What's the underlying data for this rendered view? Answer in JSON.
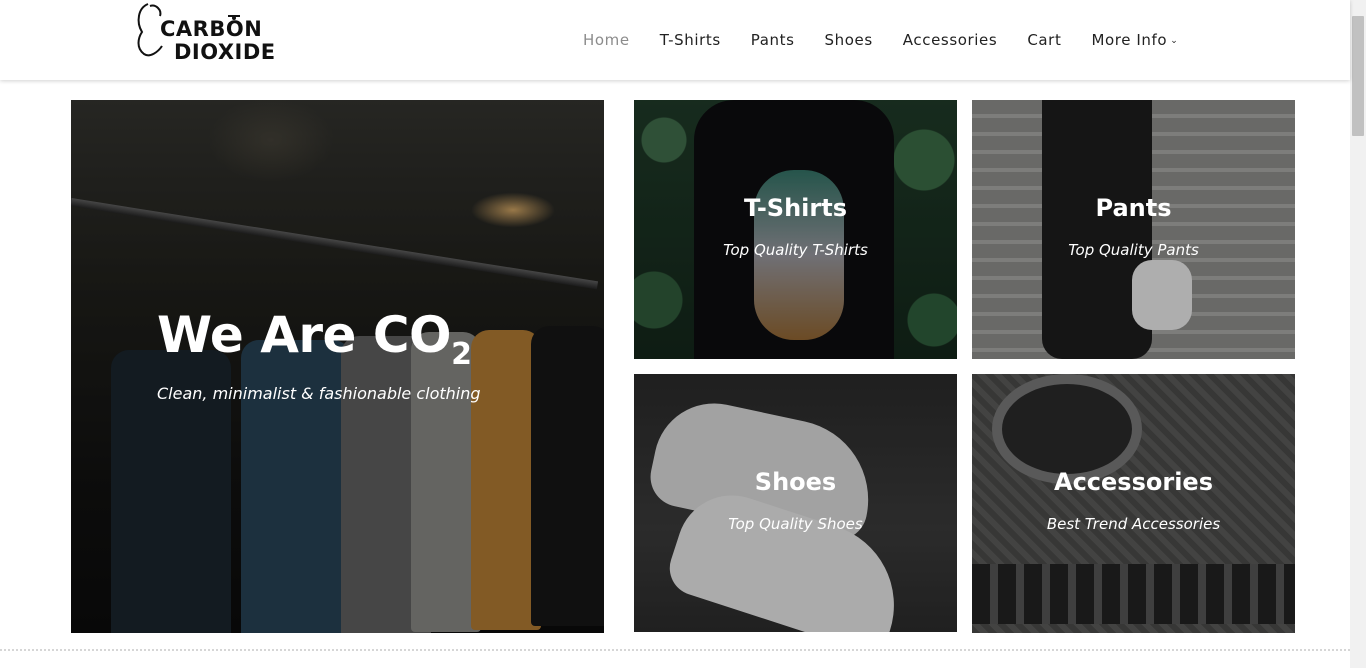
{
  "brand": {
    "line1": "CARBON",
    "line2": "DIOXIDE"
  },
  "nav": {
    "items": [
      {
        "label": "Home",
        "active": true
      },
      {
        "label": "T-Shirts",
        "active": false
      },
      {
        "label": "Pants",
        "active": false
      },
      {
        "label": "Shoes",
        "active": false
      },
      {
        "label": "Accessories",
        "active": false
      },
      {
        "label": "Cart",
        "active": false
      },
      {
        "label": "More Info",
        "active": false,
        "has_dropdown": true
      }
    ]
  },
  "hero": {
    "title": "We Are CO",
    "title_subscript": "2",
    "subtitle": "Clean, minimalist & fashionable clothing"
  },
  "categories": [
    {
      "title": "T-Shirts",
      "subtitle": "Top Quality T-Shirts"
    },
    {
      "title": "Pants",
      "subtitle": "Top Quality Pants"
    },
    {
      "title": "Shoes",
      "subtitle": "Top Quality Shoes"
    },
    {
      "title": "Accessories",
      "subtitle": "Best Trend Accessories"
    }
  ],
  "colors": {
    "nav_active": "#8c8c8c",
    "nav_text": "#222222",
    "overlay_text": "#ffffff"
  }
}
